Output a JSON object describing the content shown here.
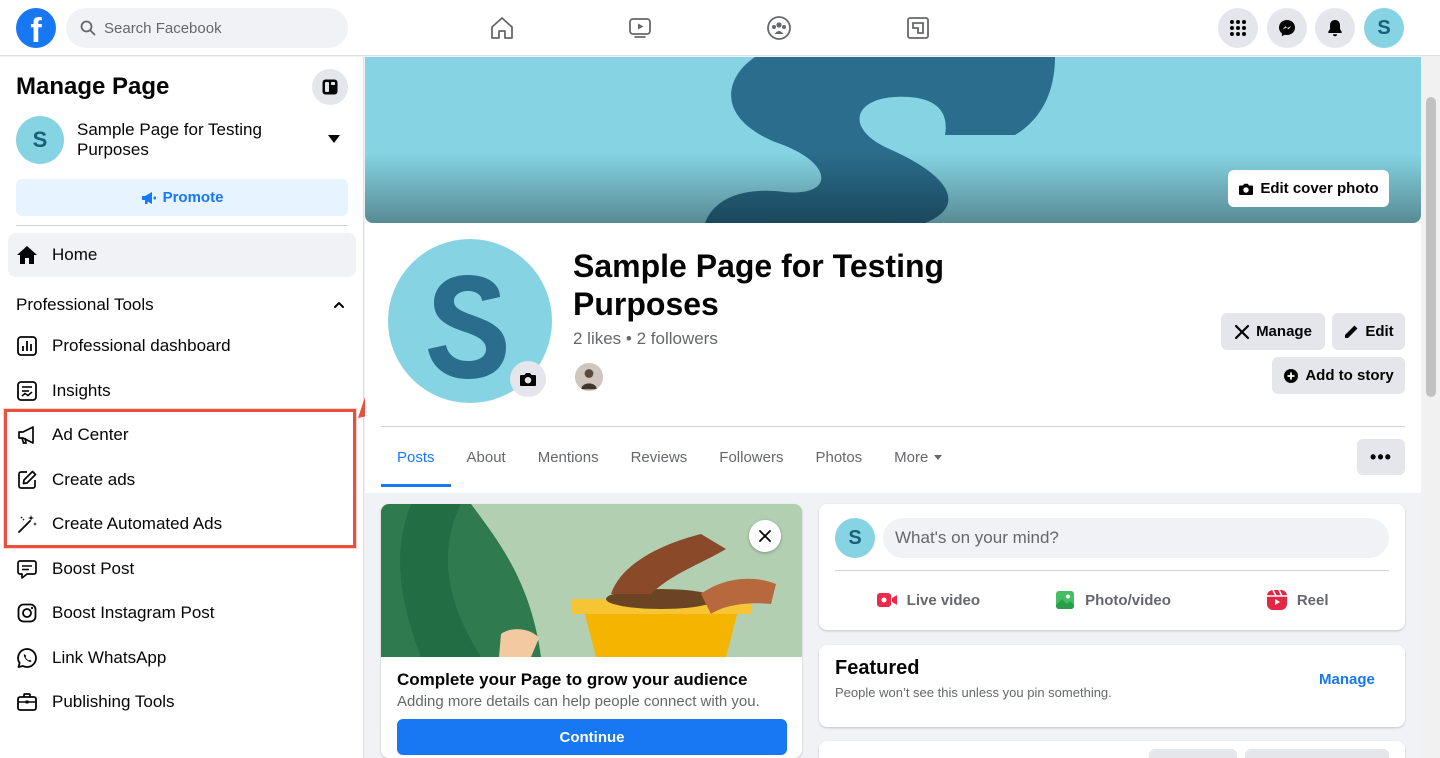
{
  "topbar": {
    "logo_letter": "f",
    "search_placeholder": "Search Facebook",
    "nav_icons": [
      "home-icon",
      "watch-icon",
      "groups-icon",
      "gaming-icon"
    ],
    "right_icons": [
      "menu-grid-icon",
      "messenger-icon",
      "notifications-icon"
    ],
    "avatar_letter": "S",
    "brand_color": "#1877f2"
  },
  "sidebar": {
    "title": "Manage Page",
    "page_avatar_letter": "S",
    "page_name": "Sample Page for Testing Purposes",
    "promote_label": "Promote",
    "home_label": "Home",
    "section_label": "Professional Tools",
    "tools": [
      {
        "label": "Professional dashboard",
        "icon": "dashboard-icon"
      },
      {
        "label": "Insights",
        "icon": "insights-icon"
      },
      {
        "label": "Ad Center",
        "icon": "megaphone-icon"
      },
      {
        "label": "Create ads",
        "icon": "pencil-square-icon"
      },
      {
        "label": "Create Automated Ads",
        "icon": "magic-wand-icon"
      },
      {
        "label": "Boost Post",
        "icon": "boost-post-icon"
      },
      {
        "label": "Boost Instagram Post",
        "icon": "instagram-icon"
      },
      {
        "label": "Link WhatsApp",
        "icon": "whatsapp-icon"
      },
      {
        "label": "Publishing Tools",
        "icon": "briefcase-icon"
      }
    ],
    "highlight_color": "#e8513e"
  },
  "main": {
    "edit_cover_label": "Edit cover photo",
    "profile_letter": "S",
    "page_name": "Sample Page for Testing Purposes",
    "stats": "2 likes • 2 followers",
    "manage_label": "Manage",
    "edit_label": "Edit",
    "add_story_label": "Add to story",
    "tabs": [
      "Posts",
      "About",
      "Mentions",
      "Reviews",
      "Followers",
      "Photos",
      "More"
    ],
    "active_tab": "Posts",
    "more_dots": "•••",
    "complete_card": {
      "title": "Complete your Page to grow your audience",
      "subtitle": "Adding more details can help people connect with you.",
      "button": "Continue"
    },
    "composer": {
      "avatar_letter": "S",
      "placeholder": "What's on your mind?",
      "actions": [
        "Live video",
        "Photo/video",
        "Reel"
      ]
    },
    "featured": {
      "title": "Featured",
      "subtitle": "People won’t see this unless you pin something.",
      "manage": "Manage"
    },
    "cover_color": "#86d4e3",
    "cover_dark": "#2a6d8c"
  }
}
